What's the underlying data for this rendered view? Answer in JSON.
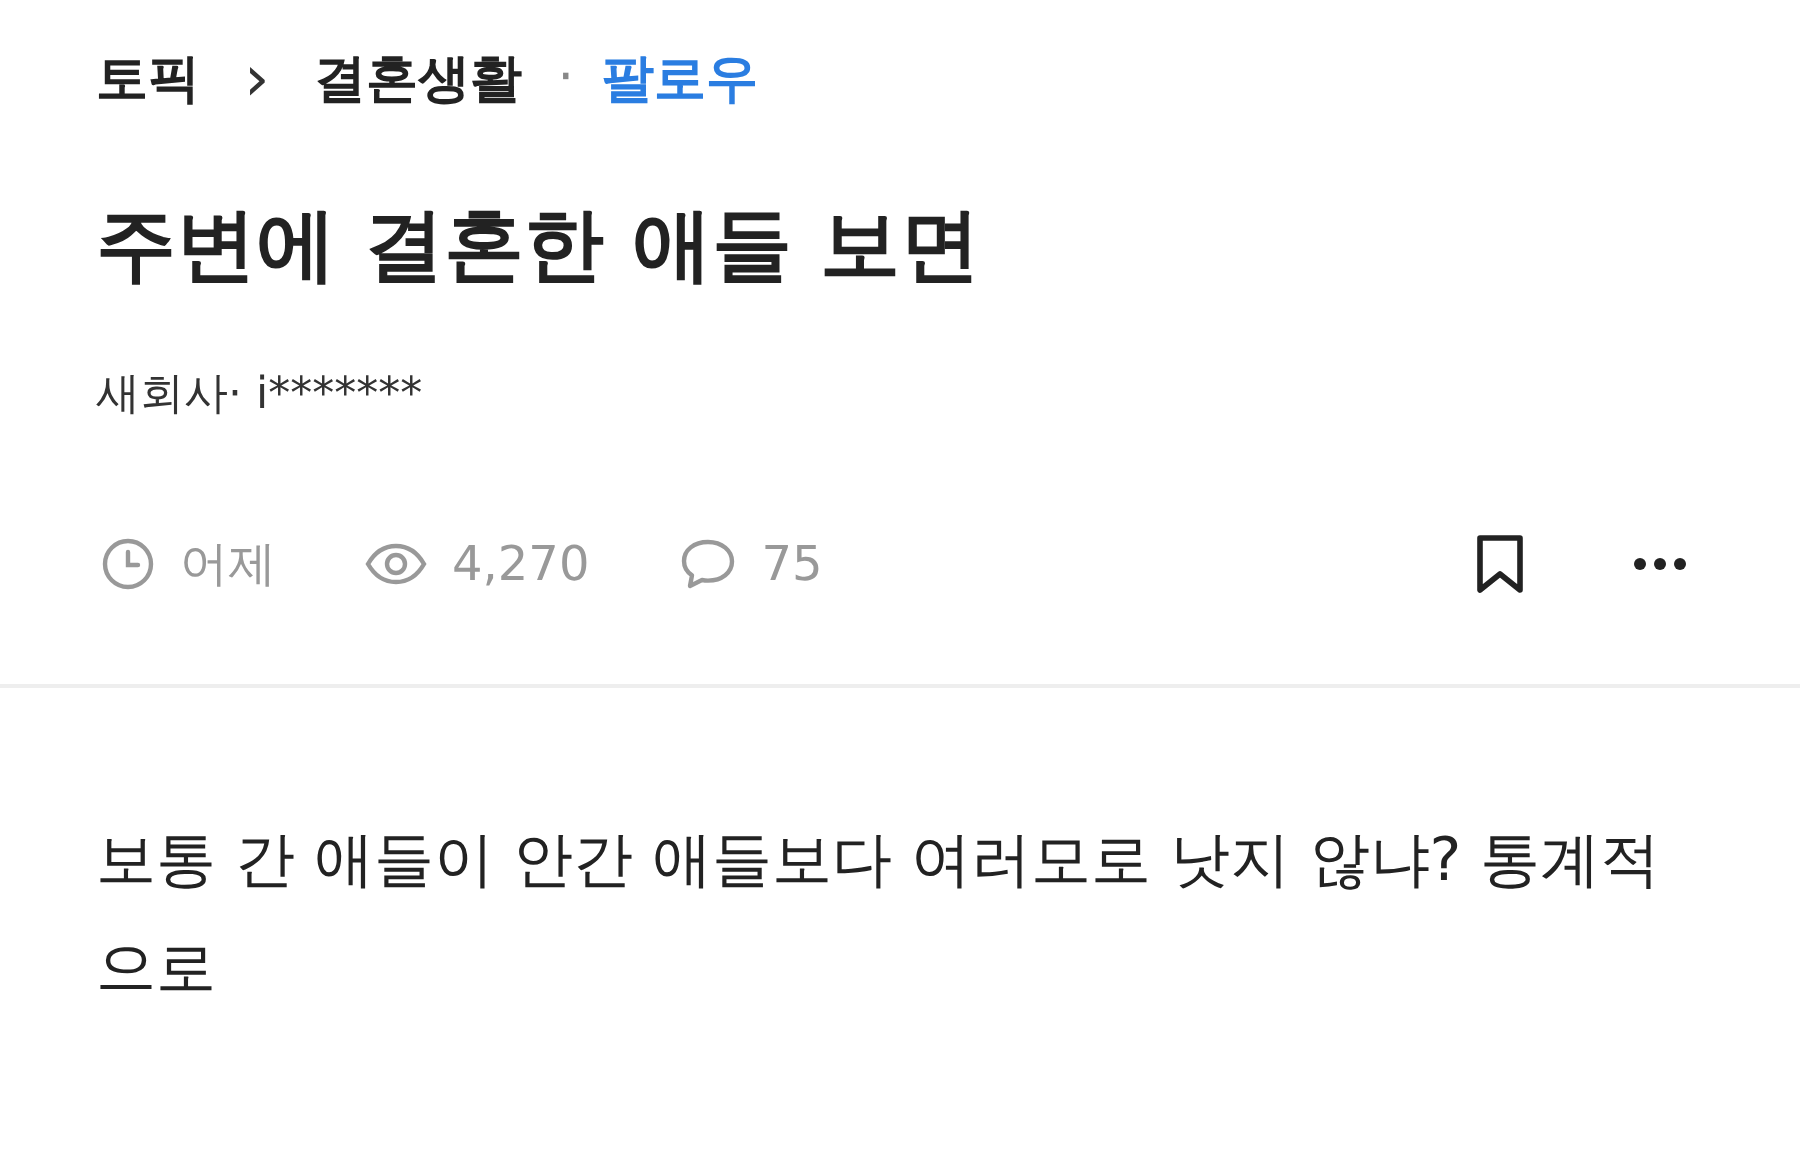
{
  "breadcrumb": {
    "topic": "토픽",
    "separator": "›",
    "category": "결혼생활",
    "dot": "·",
    "follow": "팔로우"
  },
  "post": {
    "title": "주변에 결혼한 애들 보면",
    "author": "새회사· i*******",
    "time": "어제",
    "views": "4,270",
    "comments": "75",
    "body": "보통 간 애들이 안간 애들보다 여러모로 낫지 않냐? 통계적으로"
  }
}
